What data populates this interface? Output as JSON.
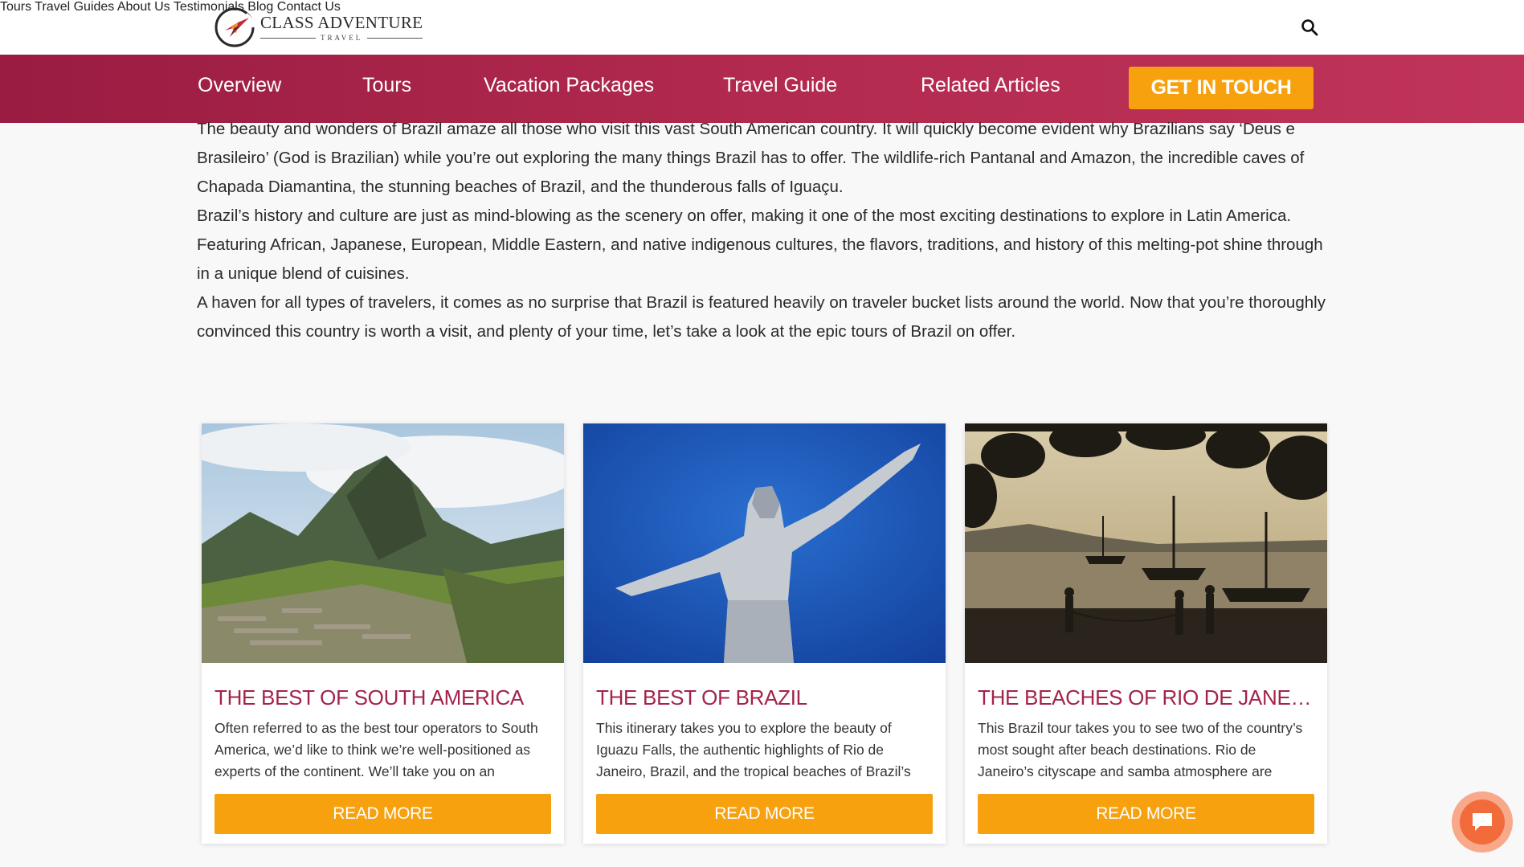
{
  "brand": {
    "name": "Class Adventure",
    "tagline": "TRAVEL"
  },
  "topnav": {
    "tours": "Tours",
    "guides": "Travel Guides",
    "about": "About Us",
    "testimonials": "Testimonials",
    "blog": "Blog",
    "contact": "Contact Us"
  },
  "subnav": {
    "overview": "Overview",
    "tours": "Tours",
    "packages": "Vacation Packages",
    "guide": "Travel Guide",
    "articles": "Related Articles",
    "cta": "GET IN TOUCH"
  },
  "intro": {
    "p1": "The beauty and wonders of Brazil amaze all those who visit this vast South American country. It will quickly become evident why Brazilians say ‘Deus e Brasileiro’ (God is Brazilian) while you’re out exploring the many things Brazil has to offer. The wildlife-rich Pantanal and Amazon, the incredible caves of Chapada Diamantina, the stunning beaches of Brazil, and the thunderous falls of Iguaçu.",
    "p2": "Brazil’s history and culture are just as mind-blowing as the scenery on offer, making it one of the most exciting destinations to explore in Latin America. Featuring African, Japanese, European, Middle Eastern, and native indigenous cultures, the flavors, traditions, and history of this melting-pot shine through in a unique blend of cuisines.",
    "p3": "A haven for all types of travelers, it comes as no surprise that Brazil is featured heavily on traveler bucket lists around the world. Now that you’re thoroughly convinced this country is worth a visit, and plenty of your time, let’s take a look at the epic tours of Brazil on offer."
  },
  "cards": [
    {
      "title": "THE BEST OF SOUTH AMERICA",
      "desc": "Often referred to as the best tour operators to South America, we’d like to think we’re well-positioned as experts of the continent. We’ll take you on an unforgettable journey.",
      "button": "READ MORE"
    },
    {
      "title": "THE BEST OF BRAZIL",
      "desc": "This itinerary takes you to explore the beauty of Iguazu Falls, the authentic highlights of Rio de Janeiro, Brazil, and the tropical beaches of Brazil’s",
      "button": "READ MORE"
    },
    {
      "title": "THE BEACHES OF RIO DE JANEIRO",
      "desc": "This Brazil tour takes you to see two of the country’s most sought after beach destinations. Rio de Janeiro’s cityscape and samba atmosphere are",
      "button": "READ MORE"
    }
  ],
  "colors": {
    "brand_red": "#a4234a",
    "accent_orange": "#f7a10f"
  }
}
